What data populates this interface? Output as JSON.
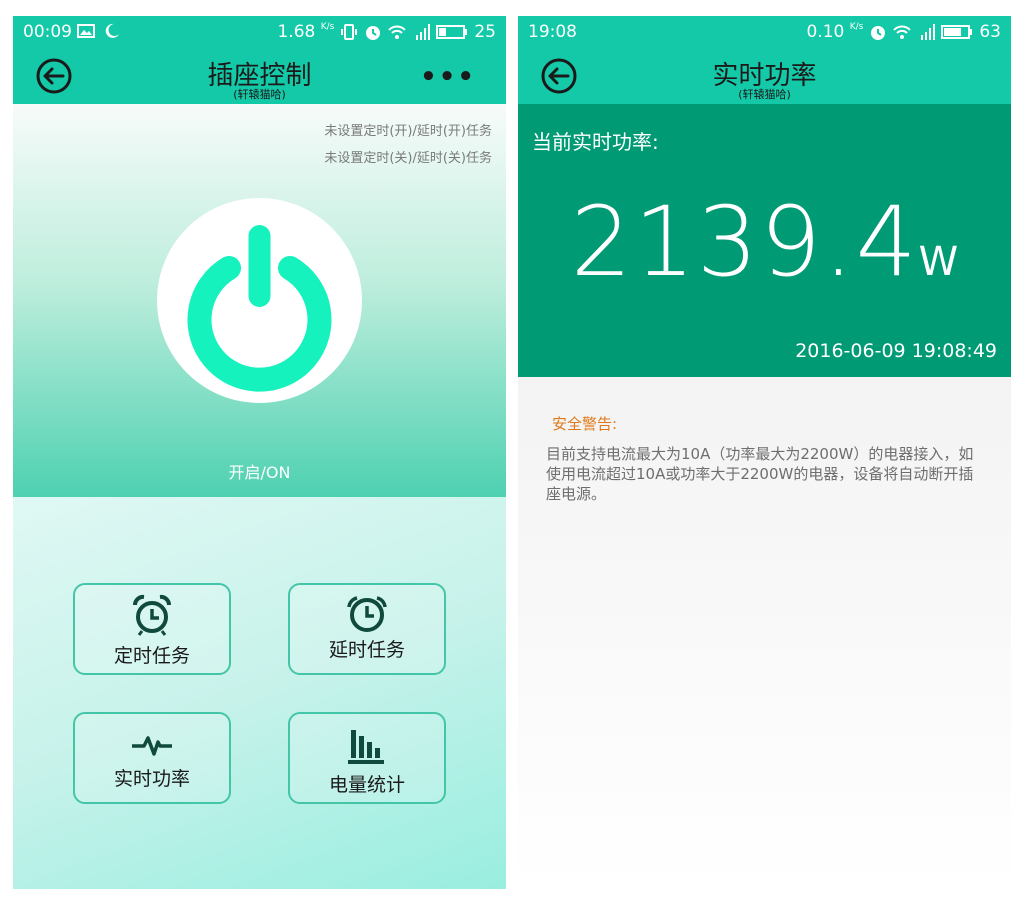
{
  "left": {
    "status": {
      "time": "00:09",
      "speed": "1.68",
      "speed_unit": "K/s",
      "battery": "25"
    },
    "header": {
      "title": "插座控制",
      "subtitle": "(轩辕猫哈)",
      "more_label": "•••"
    },
    "timer_on_note": "未设置定时(开)/延时(开)任务",
    "timer_off_note": "未设置定时(关)/延时(关)任务",
    "power_status": "开启/ON",
    "power_color": "#15f2be",
    "buttons": {
      "schedule": "定时任务",
      "delay": "延时任务",
      "realtime_power": "实时功率",
      "energy_stats": "电量统计"
    }
  },
  "right": {
    "status": {
      "time": "19:08",
      "speed": "0.10",
      "speed_unit": "K/s",
      "battery": "63"
    },
    "header": {
      "title": "实时功率",
      "subtitle": "(轩辕猫哈)"
    },
    "panel": {
      "label": "当前实时功率:",
      "value": "2139.4",
      "unit": "W",
      "timestamp": "2016-06-09 19:08:49"
    },
    "warning": {
      "title": "安全警告:",
      "text": "目前支持电流最大为10A（功率最大为2200W）的电器接入，如使用电流超过10A或功率大于2200W的电器，设备将自动断开插座电源。"
    }
  },
  "colors": {
    "accent": "#14c9a8",
    "panel": "#009a74",
    "warning": "#e07818"
  }
}
